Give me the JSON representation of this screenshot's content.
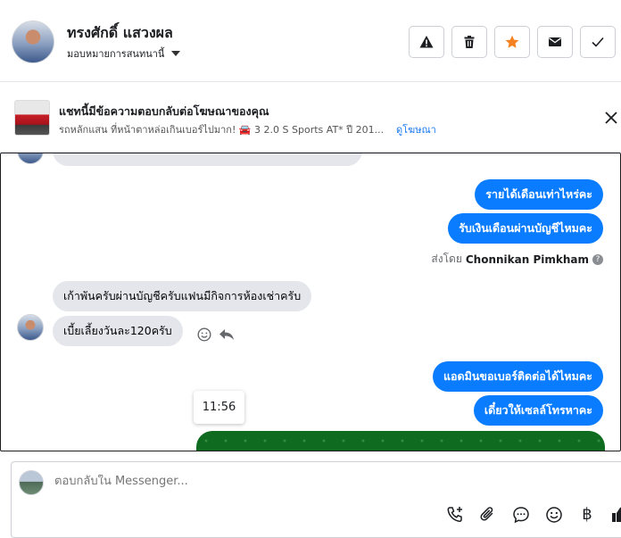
{
  "header": {
    "contact_name": "ทรงศักดิ์ แสวงผล",
    "assign_label": "มอบหมายการสนทนานี้",
    "actions": {
      "warn_icon": "warning-icon",
      "delete_icon": "trash-icon",
      "star_icon": "star-icon",
      "mail_icon": "mail-icon",
      "done_icon": "check-icon"
    },
    "accent_star": "#f5821f"
  },
  "ad": {
    "title": "แชทนี้มีข้อความตอบกลับต่อโฆษณาของคุณ",
    "subtitle": "รถหลักแสน ที่หน้าตาหล่อเกินเบอร์ไปมาก! 🚘 3 2.0 S Sports AT* ปี 201...",
    "link": "ดูโฆษณา"
  },
  "conversation": {
    "outgoing": [
      "รายได้เดือนเท่าไหร่คะ",
      "รับเงินเดือนผ่านบัญชีไหมคะ",
      "แอดมินขอเบอร์ติดต่อได้ไหมคะ",
      "เดี๋ยวให้เซลล์โทรหาคะ"
    ],
    "sent_by_prefix": "ส่งโดย",
    "sent_by_name": "Chonnikan Pimkham",
    "incoming": [
      "เก้าพันครับผ่านบัญชีครับแฟนมีกิจการห้องเช่าครับ",
      "เบี้ยเลี้ยงวันละ120ครับ"
    ],
    "tooltip_time": "11:56",
    "bubble_out_color": "#0a7cff",
    "bubble_in_color": "#e4e6eb"
  },
  "composer": {
    "placeholder": "ตอบกลับใน Messenger...",
    "baht_symbol": "฿"
  }
}
